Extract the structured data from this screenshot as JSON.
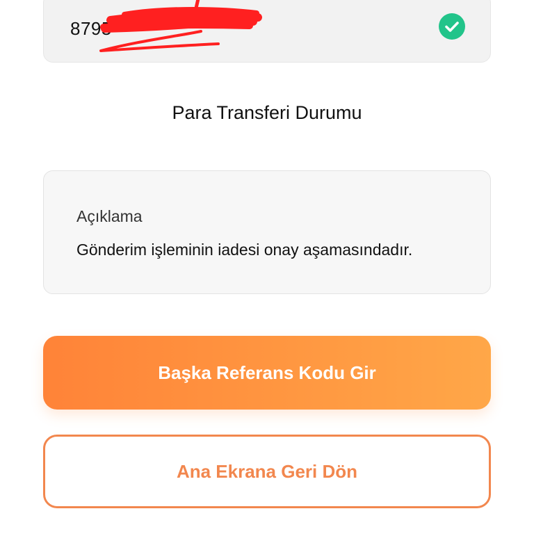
{
  "reference": {
    "value": "8795",
    "check_color": "#22c48a"
  },
  "status": {
    "title": "Para Transferi Durumu"
  },
  "description": {
    "label": "Açıklama",
    "text": "Gönderim işleminin iadesi onay aşamasındadır."
  },
  "buttons": {
    "primary_label": "Başka Referans Kodu Gir",
    "secondary_label": "Ana Ekrana Geri Dön"
  },
  "colors": {
    "accent_start": "#ff8338",
    "accent_end": "#ffa748",
    "accent_border": "#f2874e",
    "accent_text": "#f2874e",
    "redaction": "#ff2020"
  }
}
